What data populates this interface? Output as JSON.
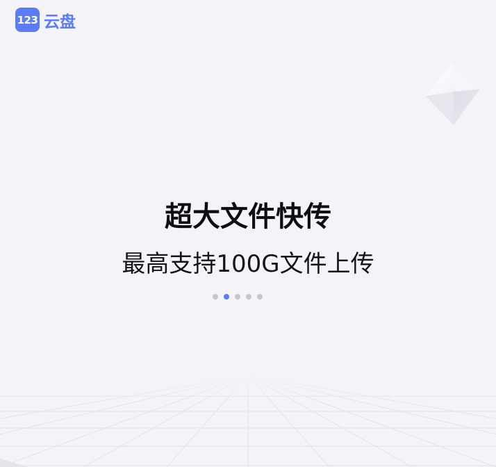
{
  "brand": {
    "badge_text": "123",
    "name": "云盘",
    "color": "#5b7cf3"
  },
  "carousel": {
    "title": "超大文件快传",
    "subtitle": "最高支持100G文件上传",
    "slide_count": 5,
    "active_index": 1,
    "dot_color": "#c4c6cc",
    "active_dot_color": "#5b7cf3"
  },
  "background_color": "#f3f3f8"
}
